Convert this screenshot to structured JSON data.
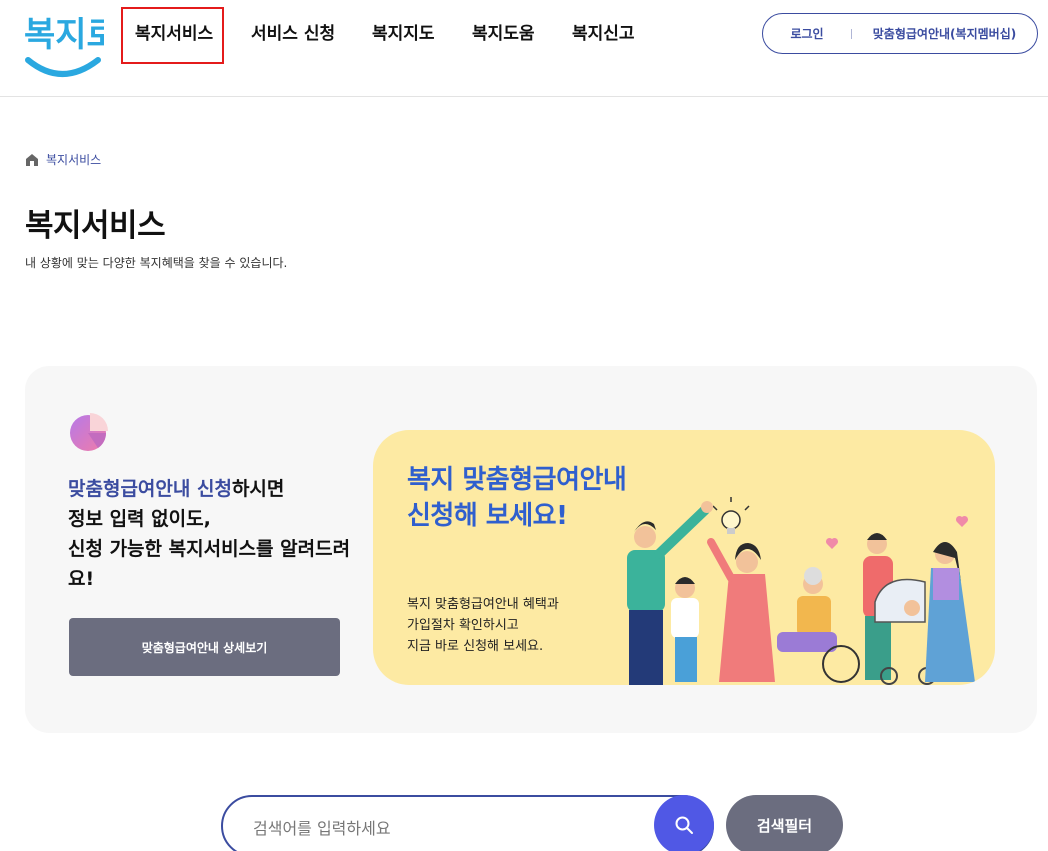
{
  "header": {
    "logo_text": "복지로",
    "nav": [
      "복지서비스",
      "서비스 신청",
      "복지지도",
      "복지도움",
      "복지신고"
    ],
    "login": "로그인",
    "membership": "맞춤형급여안내(복지멤버십)"
  },
  "breadcrumb": {
    "label": "복지서비스"
  },
  "page": {
    "title": "복지서비스",
    "subtitle": "내 상황에 맞는 다양한 복지혜택을 찾을 수 있습니다."
  },
  "promo": {
    "text_accent": "맞춤형급여안내 신청",
    "text_line1_rest": "하시면",
    "text_line2": "정보 입력 없이도,",
    "text_line3": "신청 가능한 복지서비스를 알려드려요!",
    "button": "맞춤형급여안내 상세보기",
    "banner_title_1": "복지 맞춤형급여안내",
    "banner_title_2": "신청해 보세요!",
    "banner_desc_1": "복지 맞춤형급여안내 혜택과",
    "banner_desc_2": "가입절차 확인하시고",
    "banner_desc_3": "지금 바로 신청해 보세요."
  },
  "search": {
    "placeholder": "검색어를 입력하세요",
    "filter": "검색필터"
  },
  "colors": {
    "brand": "#3b4ca0",
    "highlight": "#e41b1b",
    "banner_bg": "#fdeaa3",
    "search_btn": "#5058e5",
    "button_gray": "#6b6d7f"
  },
  "icons": [
    "home-icon",
    "pie-chart-icon",
    "search-icon"
  ]
}
